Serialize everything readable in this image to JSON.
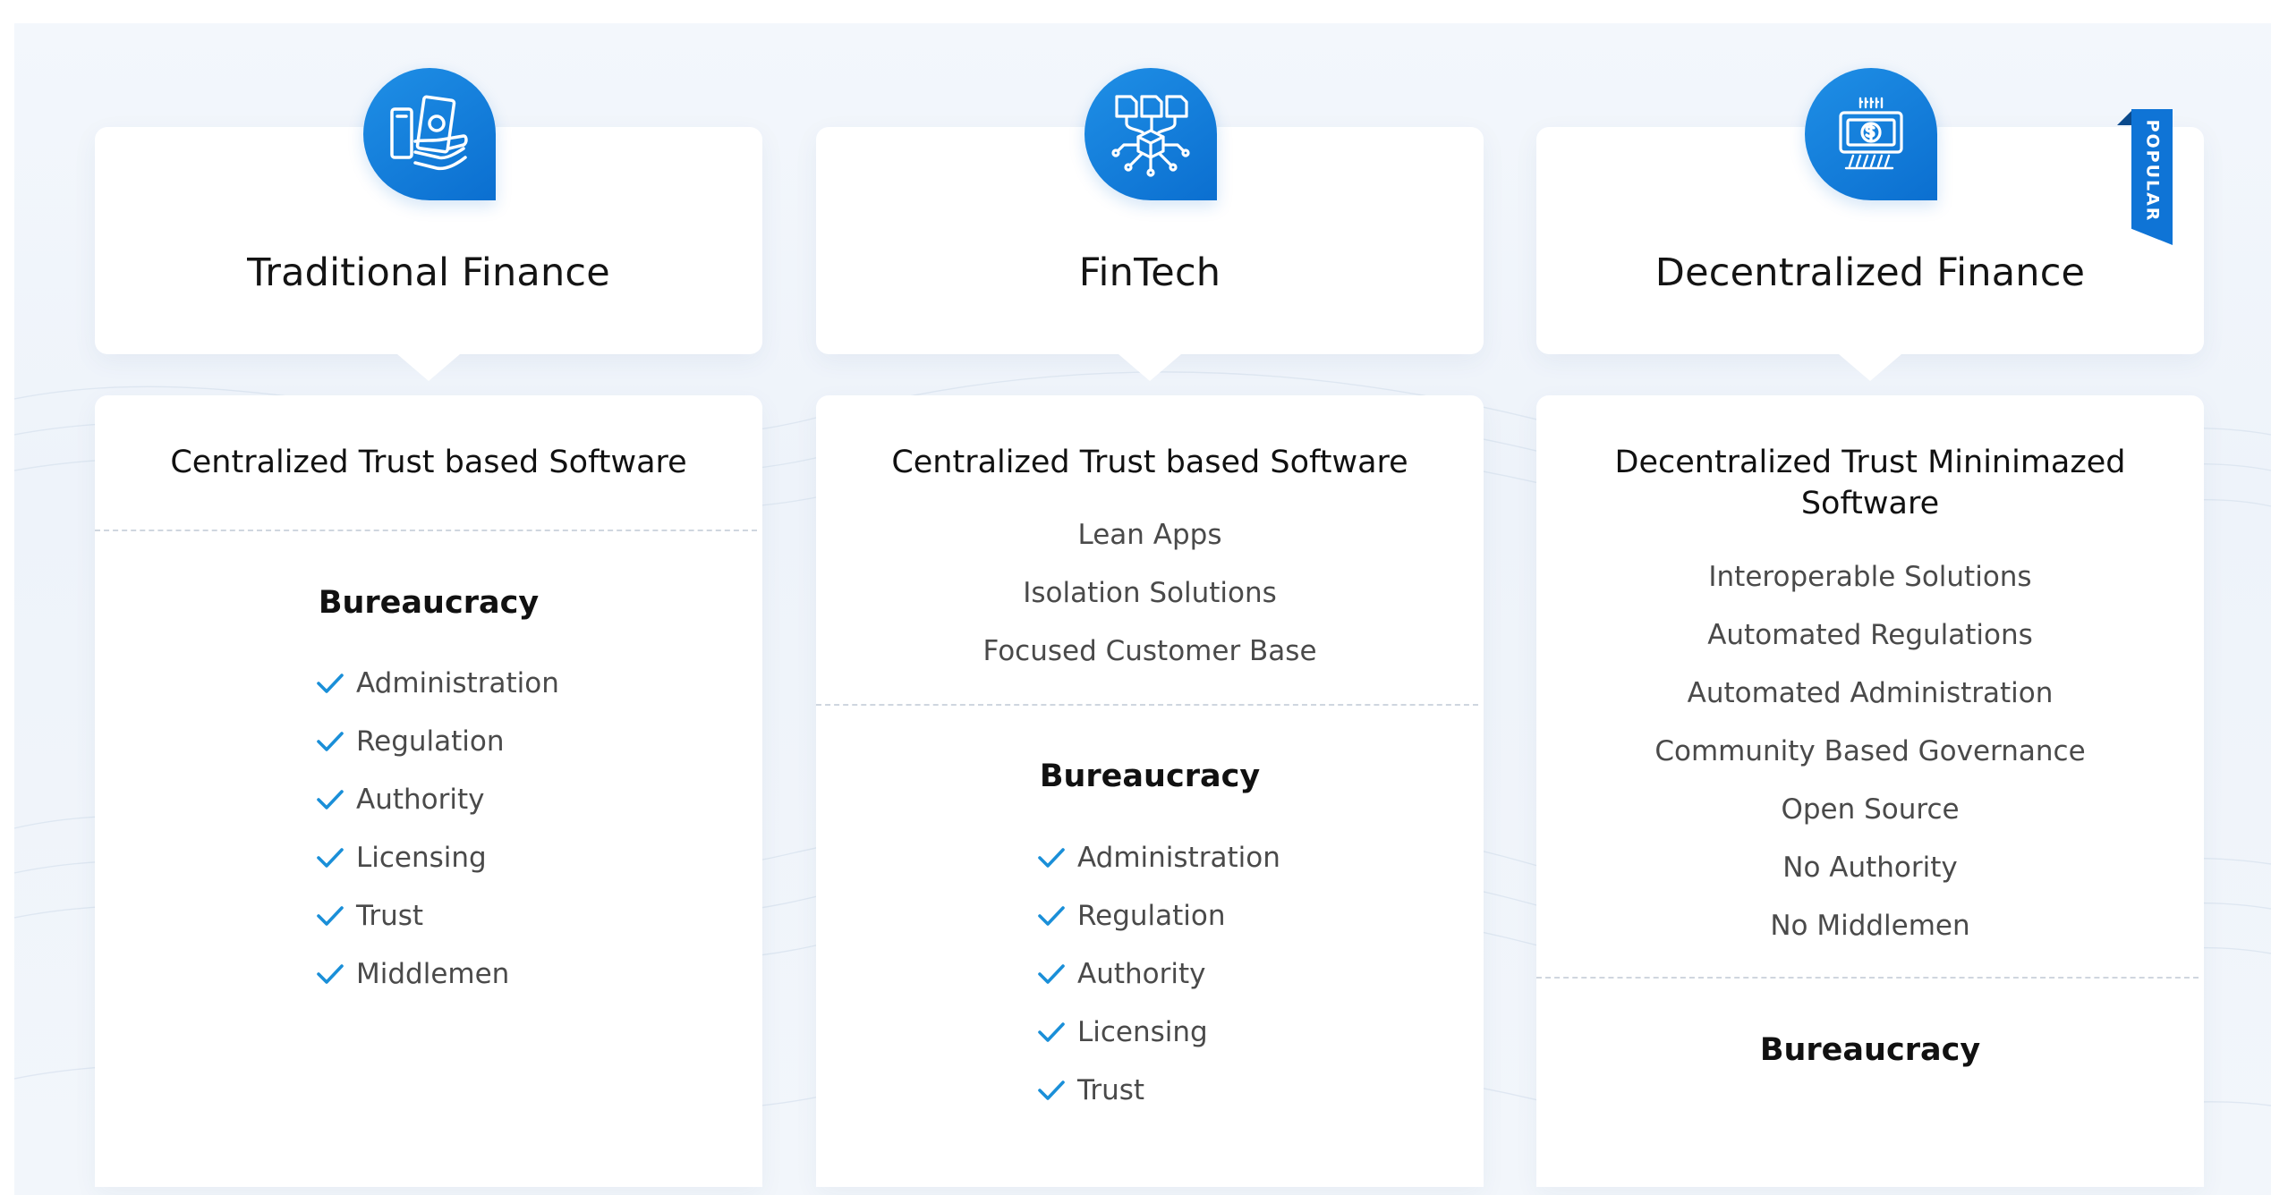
{
  "ribbon_label": "POPULAR",
  "colors": {
    "accent": "#0f74d6",
    "check": "#1a8fd8",
    "card": "#ffffff",
    "background": "#f1f5fb"
  },
  "columns": [
    {
      "icon": "money-hand-icon",
      "title": "Traditional Finance",
      "subtitle": "Centralized Trust based Software",
      "features": [],
      "bureaucracy_title": "Bureaucracy",
      "bureaucracy_items": [
        "Administration",
        "Regulation",
        "Authority",
        "Licensing",
        "Trust",
        "Middlemen"
      ]
    },
    {
      "icon": "network-documents-icon",
      "title": "FinTech",
      "subtitle": "Centralized Trust based Software",
      "features": [
        "Lean Apps",
        "Isolation Solutions",
        "Focused Customer Base"
      ],
      "bureaucracy_title": "Bureaucracy",
      "bureaucracy_items": [
        "Administration",
        "Regulation",
        "Authority",
        "Licensing",
        "Trust"
      ]
    },
    {
      "icon": "crypto-chip-icon",
      "title": "Decentralized Finance",
      "subtitle": "Decentralized Trust Mininimazed Software",
      "features": [
        "Interoperable Solutions",
        "Automated Regulations",
        "Automated Administration",
        "Community Based Governance",
        "Open Source",
        "No Authority",
        "No Middlemen"
      ],
      "bureaucracy_title": "Bureaucracy",
      "bureaucracy_items": []
    }
  ]
}
